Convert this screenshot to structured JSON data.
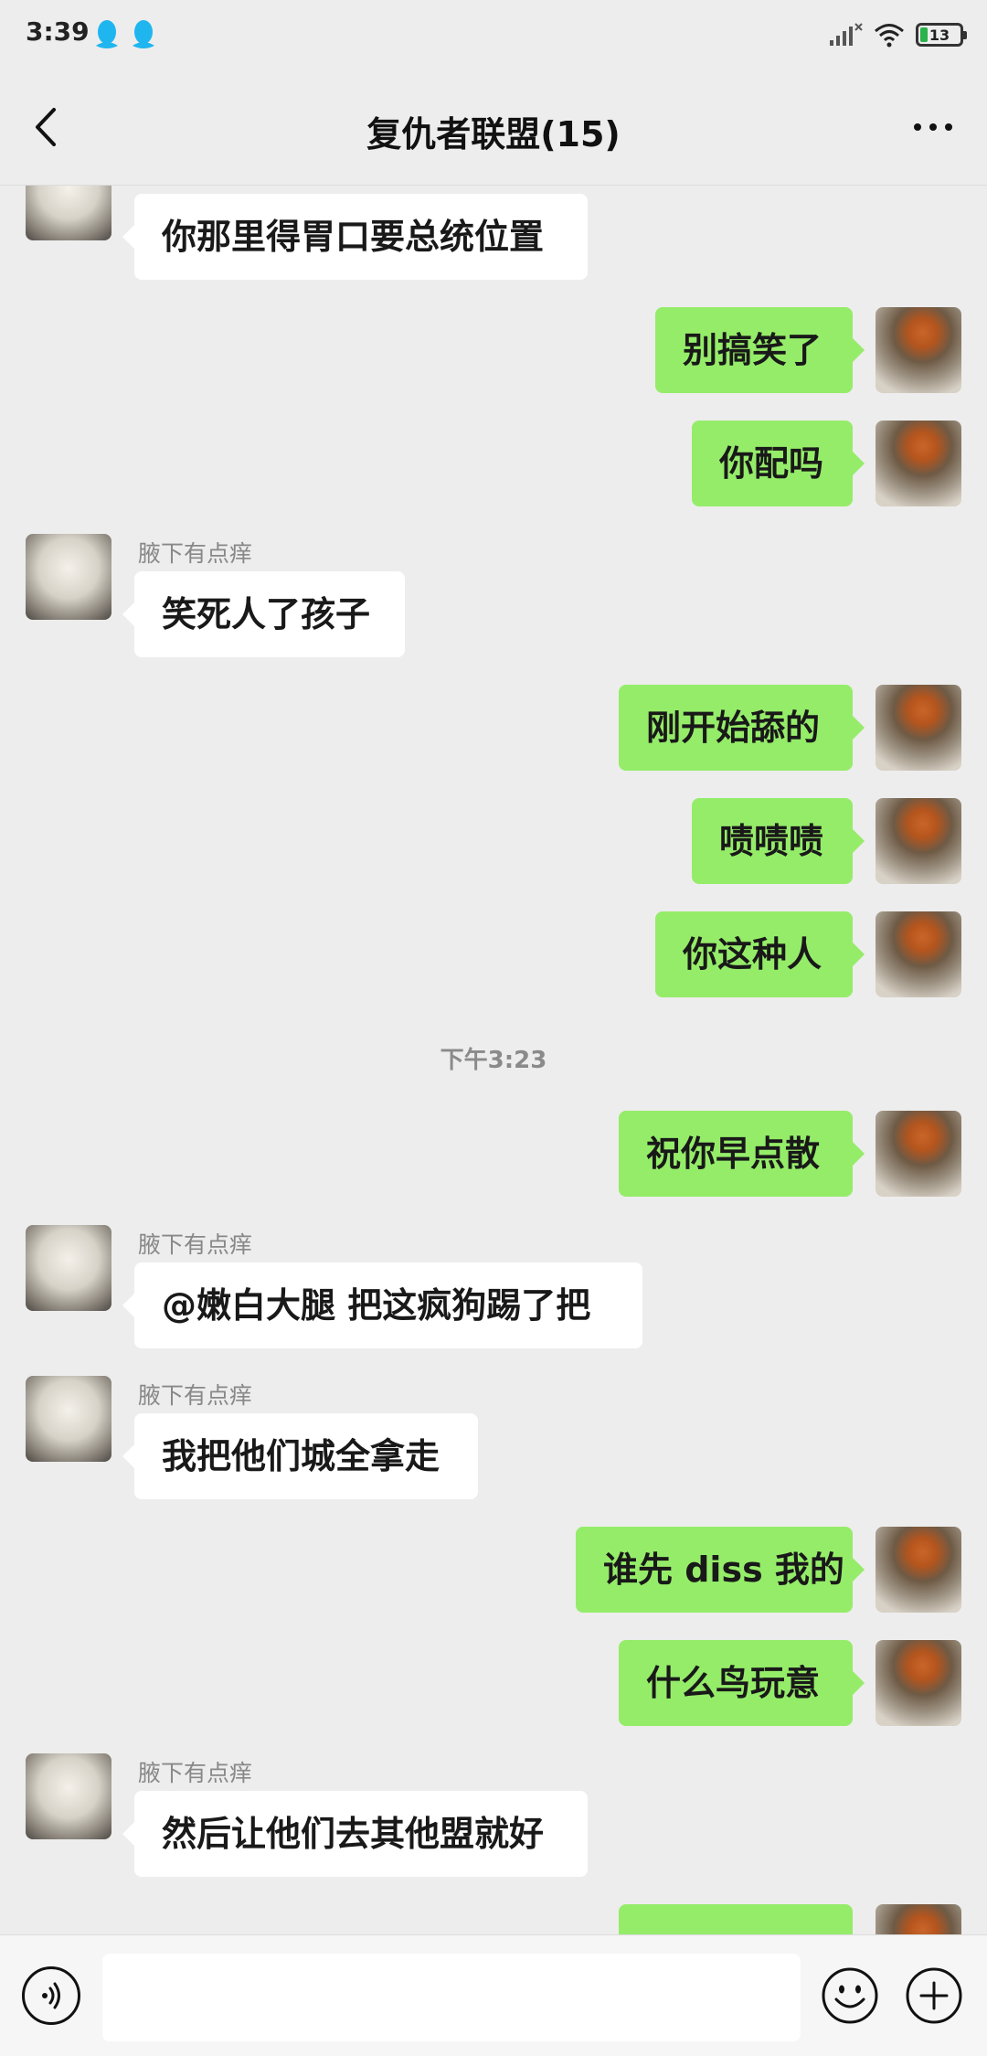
{
  "status_bar": {
    "time": "3:39",
    "battery": "13"
  },
  "nav": {
    "title": "复仇者联盟(15)"
  },
  "messages": [
    {
      "text": "你那里得胃口要总统位置"
    },
    {
      "text": "别搞笑了"
    },
    {
      "text": "你配吗"
    },
    {
      "sender": "腋下有点痒",
      "text": "笑死人了孩子"
    },
    {
      "text": "刚开始舔的"
    },
    {
      "text": "啧啧啧"
    },
    {
      "text": "你这种人"
    },
    {
      "time": "下午3:23"
    },
    {
      "text": "祝你早点散"
    },
    {
      "sender": "腋下有点痒",
      "text": "@嫩白大腿  把这疯狗踢了把"
    },
    {
      "sender": "腋下有点痒",
      "text": "我把他们城全拿走"
    },
    {
      "text": "谁先 diss 我的"
    },
    {
      "text": "什么鸟玩意"
    },
    {
      "sender": "腋下有点痒",
      "text": "然后让他们去其他盟就好"
    }
  ],
  "colors": {
    "outgoing_bubble": "#95ec69",
    "incoming_bubble": "#ffffff",
    "background": "#ededed"
  },
  "icons": [
    "qq-icon",
    "signal-icon",
    "wifi-icon",
    "battery-icon",
    "back-icon",
    "more-icon",
    "voice-icon",
    "emoji-icon",
    "plus-icon"
  ]
}
